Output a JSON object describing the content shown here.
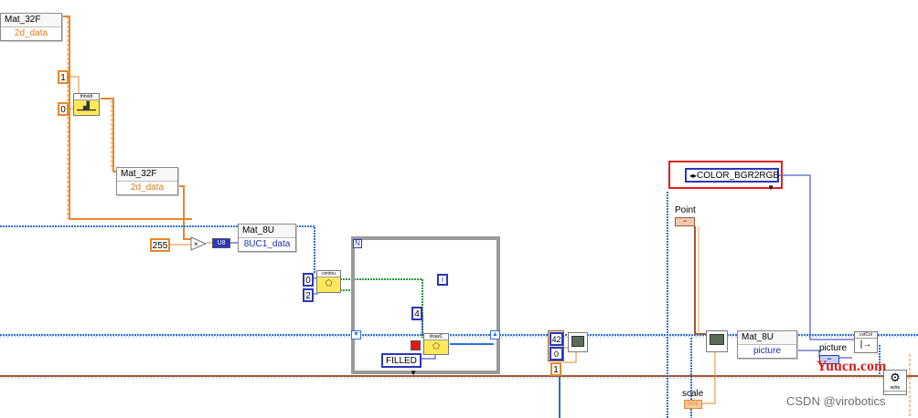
{
  "nodes": {
    "mat32f_a": {
      "title": "Mat_32F",
      "field": "2d_data"
    },
    "mat32f_b": {
      "title": "Mat_32F",
      "field": "2d_data"
    },
    "mat8u_a": {
      "title": "Mat_8U",
      "field": "8UC1_data"
    },
    "mat8u_b": {
      "title": "Mat_8U",
      "field": "picture"
    },
    "threshold_vi": "thhold",
    "contours_vi": "contou",
    "drawcontours_vi": "drawC",
    "cvtcolor_vi": "cvtCol",
    "write_vi": "write",
    "u8_convert": "U8",
    "multiply_symbol": "×"
  },
  "constants": {
    "c1": "1",
    "c0": "0",
    "c255": "255",
    "contour_a": "0",
    "contour_b": "2",
    "thickness": "4",
    "index_42": "42",
    "index_0": "0",
    "index_1": "1"
  },
  "enums": {
    "fill_mode": "FILLED",
    "color_code": "COLOR_BGR2RGB"
  },
  "labels": {
    "point": "Point",
    "scale": "scale",
    "picture": "picture",
    "loop_n": "N",
    "loop_i": "i"
  },
  "watermark": {
    "brand": "Yuucn.com",
    "credit": "CSDN @virobotics"
  },
  "colors": {
    "wire_orange": "#e8872a",
    "wire_blue": "#2e6fdb",
    "wire_green": "#1f9a3a",
    "wire_brown": "#9a5a3a",
    "highlight": "#e02020"
  }
}
